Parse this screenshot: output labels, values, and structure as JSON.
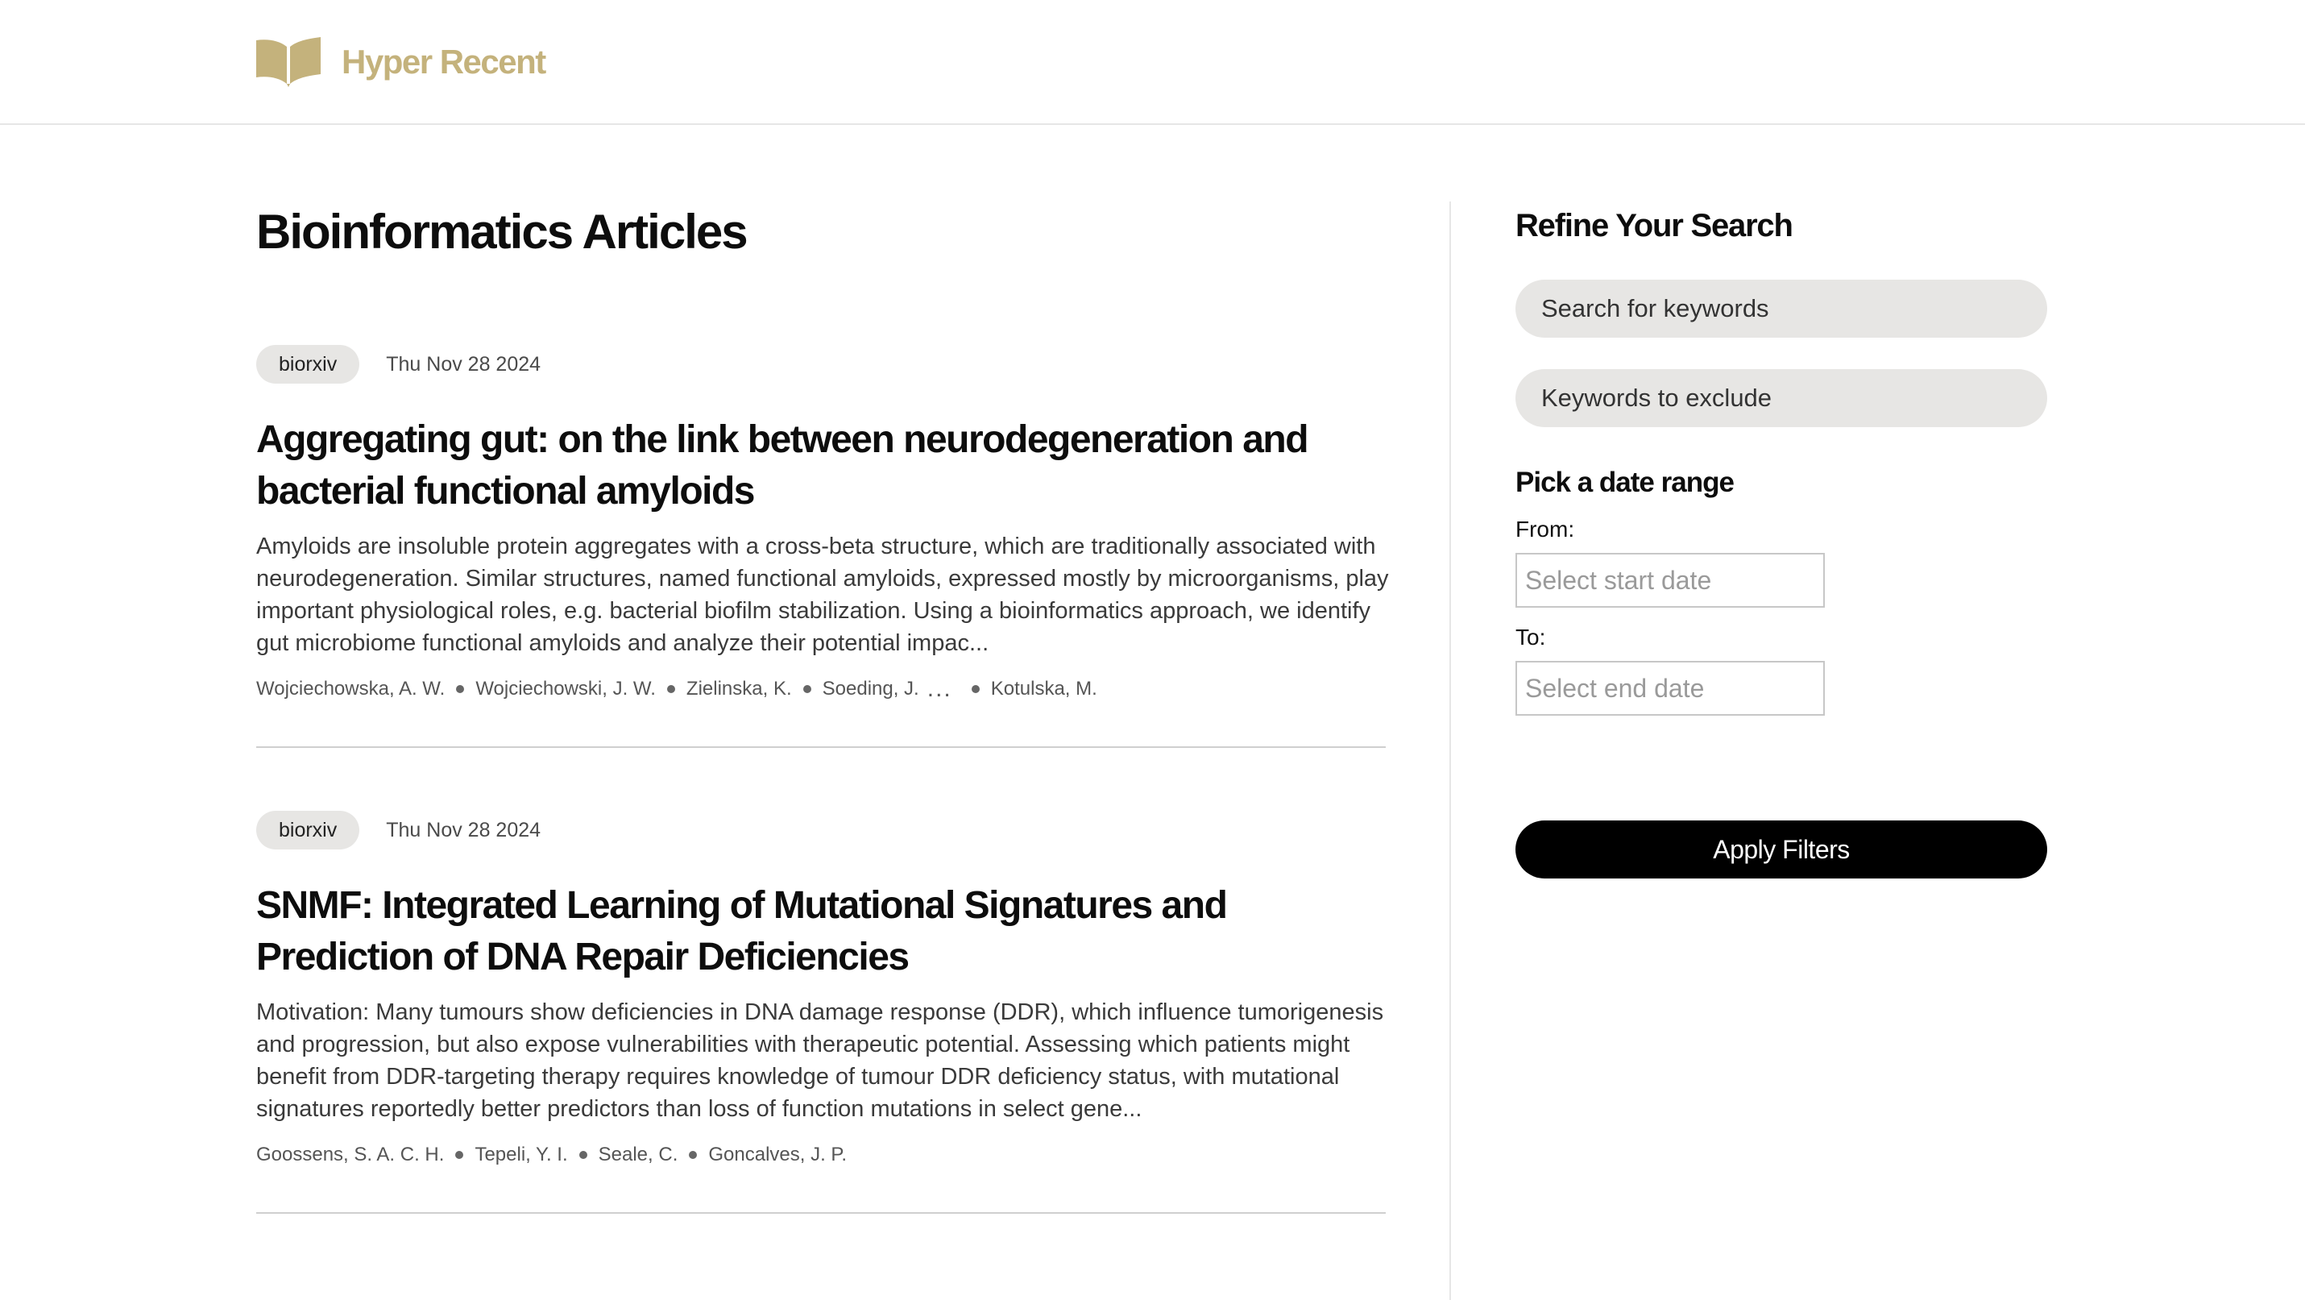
{
  "brand": {
    "name": "Hyper Recent",
    "icon": "open-book-icon",
    "color": "#c4b27c"
  },
  "page": {
    "title": "Bioinformatics Articles"
  },
  "articles": [
    {
      "source": "biorxiv",
      "date": "Thu Nov 28 2024",
      "title": "Aggregating gut: on the link between neurodegeneration and bacterial functional amyloids",
      "abstract": "Amyloids are insoluble protein aggregates with a cross-beta structure, which are traditionally associated with neurodegeneration. Similar structures, named functional amyloids, expressed mostly by microorganisms, play important physiological roles, e.g. bacterial biofilm stabilization. Using a bioinformatics approach, we identify gut microbiome functional amyloids and analyze their potential impac...",
      "authors": [
        "Wojciechowska, A. W.",
        "Wojciechowski, J. W.",
        "Zielinska, K.",
        "Soeding, J."
      ],
      "authors_ellipsis": "...",
      "last_author": "Kotulska, M."
    },
    {
      "source": "biorxiv",
      "date": "Thu Nov 28 2024",
      "title": "SNMF: Integrated Learning of Mutational Signatures and Prediction of DNA Repair Deficiencies",
      "abstract": "Motivation: Many tumours show deficiencies in DNA damage response (DDR), which influence tumorigenesis and progression, but also expose vulnerabilities with therapeutic potential. Assessing which patients might benefit from DDR-targeting therapy requires knowledge of tumour DDR deficiency status, with mutational signatures reportedly better predictors than loss of function mutations in select gene...",
      "authors": [
        "Goossens, S. A. C. H.",
        "Tepeli, Y. I.",
        "Seale, C.",
        "Goncalves, J. P."
      ]
    }
  ],
  "sidebar": {
    "title": "Refine Your Search",
    "search_placeholder": "Search for keywords",
    "exclude_placeholder": "Keywords to exclude",
    "date_heading": "Pick a date range",
    "from_label": "From:",
    "from_placeholder": "Select start date",
    "to_label": "To:",
    "to_placeholder": "Select end date",
    "apply_label": "Apply Filters"
  }
}
